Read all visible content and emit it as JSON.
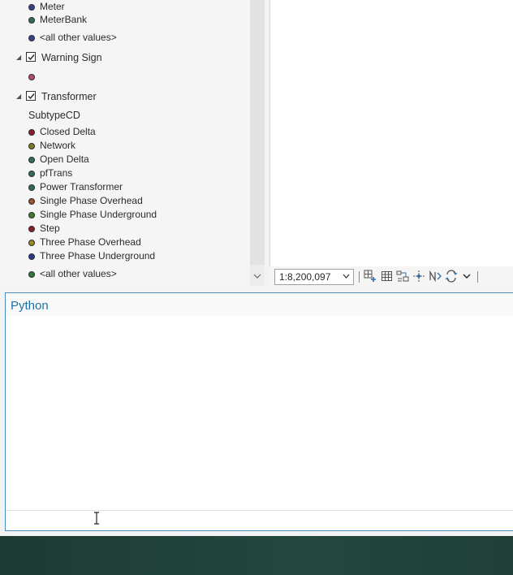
{
  "toc": {
    "top_items": [
      {
        "label": "Meter",
        "color": "#3a3f8f"
      },
      {
        "label": "MeterBank",
        "color": "#2f6e5a"
      },
      {
        "label": "<all other values>",
        "color": "#3a3f8f"
      }
    ],
    "warning_layer": {
      "name": "Warning Sign",
      "checked": true,
      "symbol_color": "#b54c6a"
    },
    "transformer_layer": {
      "name": "Transformer",
      "checked": true,
      "field_heading": "SubtypeCD",
      "items": [
        {
          "label": "Closed Delta",
          "color": "#8a1f2b"
        },
        {
          "label": "Network",
          "color": "#7a7a2a"
        },
        {
          "label": "Open Delta",
          "color": "#2f6e5a"
        },
        {
          "label": "pfTrans",
          "color": "#2f6e5a"
        },
        {
          "label": "Power Transformer",
          "color": "#2f6e5a"
        },
        {
          "label": "Single Phase Overhead",
          "color": "#a0522d"
        },
        {
          "label": "Single Phase Underground",
          "color": "#3f7a2f"
        },
        {
          "label": "Step",
          "color": "#8a1f2b"
        },
        {
          "label": "Three Phase Overhead",
          "color": "#9a8a2a"
        },
        {
          "label": "Three Phase Underground",
          "color": "#2a3a8f"
        },
        {
          "label": "<all other values>",
          "color": "#2f7a3a"
        }
      ]
    }
  },
  "statusbar": {
    "scale_value": "1:8,200,097",
    "tools": [
      "add-grid-icon",
      "table-icon",
      "snap-icon",
      "guides-icon",
      "north-arrow-icon",
      "refresh-icon"
    ]
  },
  "python": {
    "title": "Python"
  },
  "colors": {
    "accent": "#1a73a6",
    "panel_border": "#4a8dc0",
    "taskbar": "#1f3f37"
  }
}
